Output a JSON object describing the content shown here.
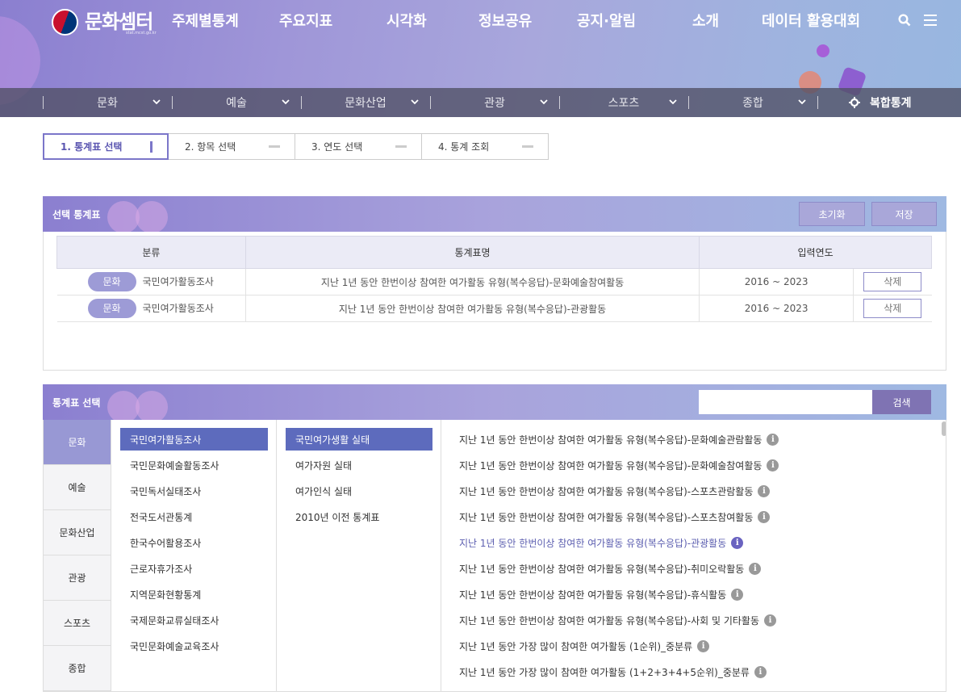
{
  "header": {
    "logo_text": "문화셈터",
    "logo_sub": "stat.mcst.go.kr",
    "gnb": [
      "주제별통계",
      "주요지표",
      "시각화",
      "정보공유",
      "공지·알림",
      "소개",
      "데이터 활용대회"
    ]
  },
  "subnav": {
    "items": [
      "문화",
      "예술",
      "문화산업",
      "관광",
      "스포츠",
      "종합"
    ],
    "compound": "복합통계"
  },
  "steps": [
    "1. 통계표 선택",
    "2. 항목 선택",
    "3. 연도 선택",
    "4. 통계 조회"
  ],
  "selected_panel": {
    "title": "선택 통계표",
    "reset_label": "초기화",
    "save_label": "저장",
    "columns": [
      "분류",
      "통계표명",
      "입력연도"
    ],
    "rows": [
      {
        "category": "문화",
        "survey": "국민여가활동조사",
        "name": "지난 1년 동안 한번이상 참여한 여가활동 유형(복수응답)-문화예술참여활동",
        "years": "2016 ~ 2023",
        "delete": "삭제"
      },
      {
        "category": "문화",
        "survey": "국민여가활동조사",
        "name": "지난 1년 동안 한번이상 참여한 여가활동 유형(복수응답)-관광활동",
        "years": "2016 ~ 2023",
        "delete": "삭제"
      }
    ]
  },
  "browse_panel": {
    "title": "통계표 선택",
    "search_placeholder": "",
    "search_label": "검색",
    "categories": [
      "문화",
      "예술",
      "문화산업",
      "관광",
      "스포츠",
      "종합"
    ],
    "surveys": [
      "국민여가활동조사",
      "국민문화예술활동조사",
      "국민독서실태조사",
      "전국도서관통계",
      "한국수어활용조사",
      "근로자휴가조사",
      "지역문화현황통계",
      "국제문화교류실태조사",
      "국민문화예술교육조사"
    ],
    "subgroups": [
      "국민여가생활 실태",
      "여가자원 실태",
      "여가인식 실태",
      "2010년 이전 통계표"
    ],
    "tables": [
      "지난 1년 동안 한번이상 참여한 여가활동 유형(복수응답)-문화예술관람활동",
      "지난 1년 동안 한번이상 참여한 여가활동 유형(복수응답)-문화예술참여활동",
      "지난 1년 동안 한번이상 참여한 여가활동 유형(복수응답)-스포츠관람활동",
      "지난 1년 동안 한번이상 참여한 여가활동 유형(복수응답)-스포츠참여활동",
      "지난 1년 동안 한번이상 참여한 여가활동 유형(복수응답)-관광활동",
      "지난 1년 동안 한번이상 참여한 여가활동 유형(복수응답)-취미오락활동",
      "지난 1년 동안 한번이상 참여한 여가활동 유형(복수응답)-휴식활동",
      "지난 1년 동안 한번이상 참여한 여가활동 유형(복수응답)-사회 및 기타활동",
      "지난 1년 동안 가장 많이 참여한 여가활동 (1순위)_중분류",
      "지난 1년 동안 가장 많이 참여한 여가활동 (1+2+3+4+5순위)_중분류"
    ],
    "info_glyph": "i"
  },
  "colors": {
    "accent": "#7b76c9",
    "selected": "#5d6bbd",
    "pill": "#9d9bd6"
  }
}
